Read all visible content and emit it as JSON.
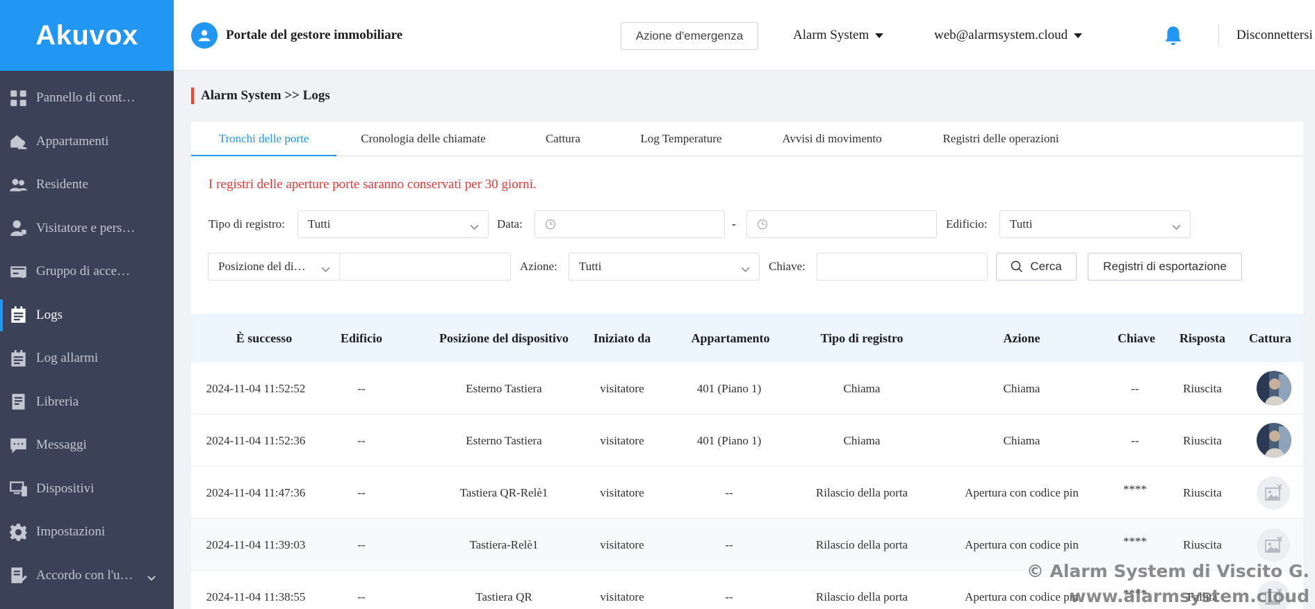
{
  "brand": {
    "logo_text": "Akuvox"
  },
  "sidebar": {
    "items": [
      {
        "label": "Pannello di cont…",
        "icon": "dashboard-icon",
        "active": false
      },
      {
        "label": "Appartamenti",
        "icon": "apartment-icon",
        "active": false
      },
      {
        "label": "Residente",
        "icon": "residents-icon",
        "active": false
      },
      {
        "label": "Visitatore e pers…",
        "icon": "visitor-icon",
        "active": false
      },
      {
        "label": "Gruppo di acce…",
        "icon": "access-card-icon",
        "active": false
      },
      {
        "label": "Logs",
        "icon": "logs-icon",
        "active": true
      },
      {
        "label": "Log allarmi",
        "icon": "alarm-log-icon",
        "active": false
      },
      {
        "label": "Libreria",
        "icon": "library-icon",
        "active": false
      },
      {
        "label": "Messaggi",
        "icon": "messages-icon",
        "active": false
      },
      {
        "label": "Dispositivi",
        "icon": "devices-icon",
        "active": false
      },
      {
        "label": "Impostazioni",
        "icon": "gear-icon",
        "active": false
      },
      {
        "label": "Accordo con l'u…",
        "icon": "agreement-icon",
        "active": false
      }
    ]
  },
  "header": {
    "title": "Portale del gestore immobiliare",
    "emergency_label": "Azione d'emergenza",
    "project_label": "Alarm System",
    "account_label": "web@alarmsystem.cloud",
    "logout_label": "Disconnettersi"
  },
  "breadcrumb": {
    "parent": "Alarm System",
    "separator": ">>",
    "current": "Logs"
  },
  "tabs": [
    {
      "label": "Tronchi delle porte",
      "active": true
    },
    {
      "label": "Cronologia delle chiamate",
      "active": false
    },
    {
      "label": "Cattura",
      "active": false
    },
    {
      "label": "Log Temperature",
      "active": false
    },
    {
      "label": "Avvisi di movimento",
      "active": false
    },
    {
      "label": "Registri delle operazioni",
      "active": false
    }
  ],
  "notice": "I registri delle aperture porte saranno conservati per 30 giorni.",
  "filters": {
    "log_type_label": "Tipo di registro:",
    "log_type_value": "Tutti",
    "date_label": "Data:",
    "date_separator": "-",
    "building_label": "Edificio:",
    "building_value": "Tutti",
    "device_position_value": "Posizione del di…",
    "action_label": "Azione:",
    "action_value": "Tutti",
    "key_label": "Chiave:",
    "search_label": "Cerca",
    "export_label": "Registri di esportazione"
  },
  "table": {
    "columns": [
      "È successo",
      "Edificio",
      "Posizione del dispositivo",
      "Iniziato da",
      "Appartamento",
      "Tipo di registro",
      "Azione",
      "Chiave",
      "Risposta",
      "Cattura"
    ],
    "rows": [
      [
        "2024-11-04 11:52:52",
        "--",
        "Esterno Tastiera",
        "visitatore",
        "401 (Piano 1)",
        "Chiama",
        "Chiama",
        "--",
        "Riuscita"
      ],
      [
        "2024-11-04 11:52:36",
        "--",
        "Esterno Tastiera",
        "visitatore",
        "401 (Piano 1)",
        "Chiama",
        "Chiama",
        "--",
        "Riuscita"
      ],
      [
        "2024-11-04 11:47:36",
        "--",
        "Tastiera QR-Relè1",
        "visitatore",
        "--",
        "Rilascio della porta",
        "Apertura con codice pin",
        "****",
        "Riuscita"
      ],
      [
        "2024-11-04 11:39:03",
        "--",
        "Tastiera-Relè1",
        "visitatore",
        "--",
        "Rilascio della porta",
        "Apertura con codice pin",
        "****",
        "Riuscita"
      ],
      [
        "2024-11-04 11:38:55",
        "--",
        "Tastiera QR",
        "visitatore",
        "--",
        "Rilascio della porta",
        "Apertura con codice pin",
        "****",
        "Fallita"
      ]
    ]
  },
  "watermark": {
    "line1": "© Alarm System di Viscito G.",
    "line2": "www.alarmsystem.cloud"
  },
  "colors": {
    "brand_blue": "#2196f3",
    "sidebar_bg": "#3b4156",
    "notice_red": "#e53935"
  }
}
